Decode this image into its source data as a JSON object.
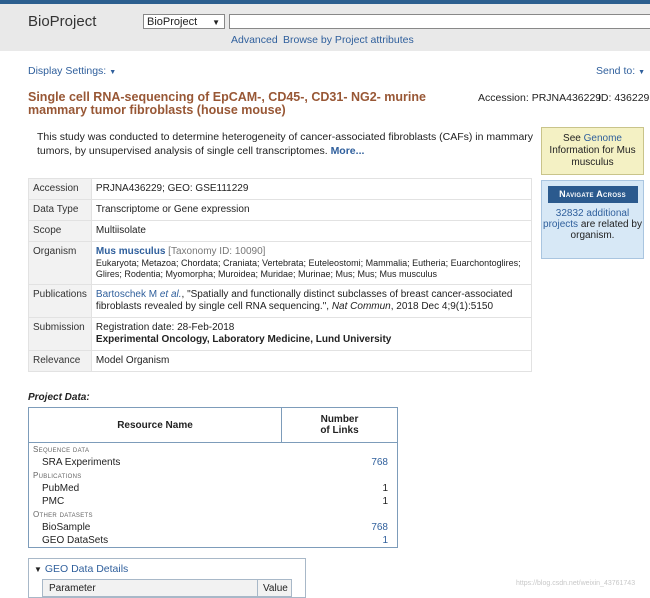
{
  "header": {
    "db_title": "BioProject",
    "db_select_value": "BioProject",
    "search_value": "",
    "advanced_link": "Advanced",
    "browse_link": "Browse by Project attributes"
  },
  "toolbar": {
    "display_settings": "Display Settings:",
    "send_to": "Send to:"
  },
  "project": {
    "title": "Single cell RNA-sequencing of EpCAM-, CD45-, CD31- NG2- murine mammary tumor fibroblasts (house mouse)",
    "accession_label": "Accession: PRJNA436229",
    "id_label": "ID: 436229",
    "description": "This study was conducted to determine heterogeneity of cancer-associated fibroblasts (CAFs) in mammary tumors, by unsupervised analysis of single cell transcriptomes.",
    "more_link": "More..."
  },
  "sidebar": {
    "genome_box": {
      "see": "See",
      "genome_link": "Genome",
      "rest": "Information for Mus musculus"
    },
    "nav_box": {
      "button": "Navigate Across",
      "count_link": "32832 additional projects",
      "rest": "are related by organism."
    }
  },
  "info": {
    "accession": {
      "label": "Accession",
      "value": "PRJNA436229; GEO: GSE111229"
    },
    "data_type": {
      "label": "Data Type",
      "value": "Transcriptome or Gene expression"
    },
    "scope": {
      "label": "Scope",
      "value": "Multiisolate"
    },
    "organism": {
      "label": "Organism",
      "name": "Mus musculus",
      "taxonomy": "[Taxonomy ID: 10090]",
      "lineage": "Eukaryota; Metazoa; Chordata; Craniata; Vertebrata; Euteleostomi; Mammalia; Eutheria; Euarchontoglires; Glires; Rodentia; Myomorpha; Muroidea; Muridae; Murinae; Mus; Mus; Mus musculus"
    },
    "publications": {
      "label": "Publications",
      "authors": "Bartoschek M",
      "etal": "et al.",
      "title_text": ", \"Spatially and functionally distinct subclasses of breast cancer-associated fibroblasts revealed by single cell RNA sequencing.\", ",
      "journal": "Nat Commun",
      "citation": ", 2018 Dec 4;9(1):5150"
    },
    "submission": {
      "label": "Submission",
      "date": "Registration date: 28-Feb-2018",
      "org": "Experimental Oncology, Laboratory Medicine, Lund University"
    },
    "relevance": {
      "label": "Relevance",
      "value": "Model Organism"
    }
  },
  "project_data": {
    "label": "Project Data:",
    "col_resource": "Resource Name",
    "col_links_1": "Number",
    "col_links_2": "of Links",
    "rows": [
      {
        "category": "Sequence data"
      },
      {
        "name": "SRA Experiments",
        "value": "768",
        "link": true
      },
      {
        "category": "Publications"
      },
      {
        "name": "PubMed",
        "value": "1",
        "link": false
      },
      {
        "name": "PMC",
        "value": "1",
        "link": false
      },
      {
        "category": "Other datasets"
      },
      {
        "name": "BioSample",
        "value": "768",
        "link": true
      },
      {
        "name": "GEO DataSets",
        "value": "1",
        "link": true
      }
    ]
  },
  "geo_details": {
    "title": "GEO Data Details",
    "col_param": "Parameter",
    "col_value": "Value"
  },
  "watermark": "https://blog.csdn.net/weixin_43761743"
}
